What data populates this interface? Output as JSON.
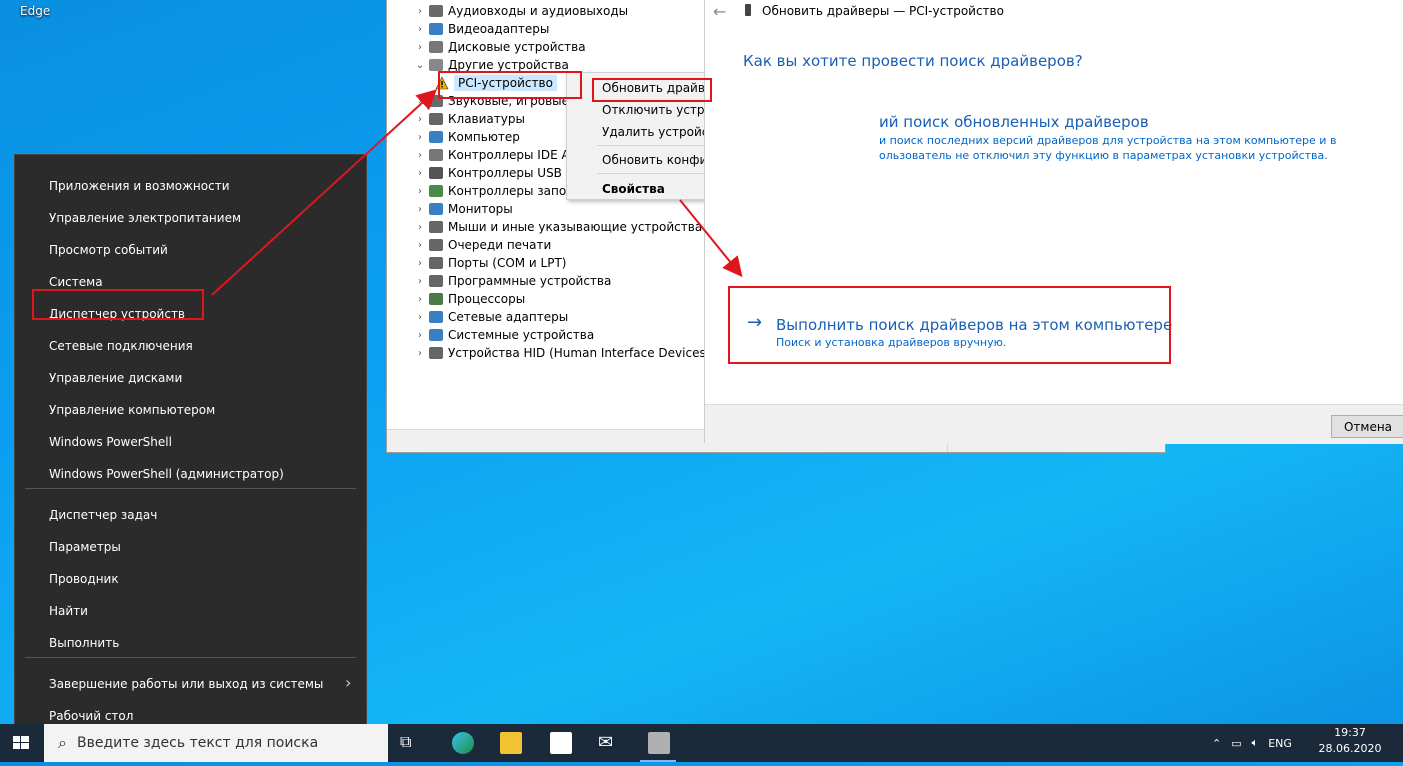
{
  "desktop": {
    "edge_label": "Edge"
  },
  "device_manager": {
    "tree": [
      {
        "label": "Аудиовходы и аудиовыходы",
        "icon": "audio-icon",
        "color": "#6a6a6a"
      },
      {
        "label": "Видеоадаптеры",
        "icon": "display-adapter-icon",
        "color": "#3a7fc1"
      },
      {
        "label": "Дисковые устройства",
        "icon": "disk-icon",
        "color": "#777"
      },
      {
        "label": "Другие устройства",
        "icon": "unknown-device-icon",
        "color": "#888"
      },
      {
        "label": "PCI-устройство",
        "icon": "warning-icon",
        "color": "#e8b200"
      },
      {
        "label": "Звуковые, игровые и",
        "icon": "sound-icon",
        "color": "#6a6a6a"
      },
      {
        "label": "Клавиатуры",
        "icon": "keyboard-icon",
        "color": "#666"
      },
      {
        "label": "Компьютер",
        "icon": "computer-icon",
        "color": "#3a7fc1"
      },
      {
        "label": "Контроллеры IDE ATA",
        "icon": "ide-icon",
        "color": "#777"
      },
      {
        "label": "Контроллеры USB",
        "icon": "usb-icon",
        "color": "#555"
      },
      {
        "label": "Контроллеры запом",
        "icon": "storage-icon",
        "color": "#4a8a4a"
      },
      {
        "label": "Мониторы",
        "icon": "monitor-icon",
        "color": "#3a7fc1"
      },
      {
        "label": "Мыши и иные указывающие устройства",
        "icon": "mouse-icon",
        "color": "#666"
      },
      {
        "label": "Очереди печати",
        "icon": "printer-icon",
        "color": "#666"
      },
      {
        "label": "Порты (COM и LPT)",
        "icon": "port-icon",
        "color": "#666"
      },
      {
        "label": "Программные устройства",
        "icon": "software-device-icon",
        "color": "#666"
      },
      {
        "label": "Процессоры",
        "icon": "cpu-icon",
        "color": "#4a7a4a"
      },
      {
        "label": "Сетевые адаптеры",
        "icon": "network-icon",
        "color": "#3a7fc1"
      },
      {
        "label": "Системные устройства",
        "icon": "system-icon",
        "color": "#3a7fc1"
      },
      {
        "label": "Устройства HID (Human Interface Devices)",
        "icon": "hid-icon",
        "color": "#666"
      }
    ],
    "context_menu": {
      "update": "Обновить драйвер",
      "disable": "Отключить устройство",
      "uninstall": "Удалить устройство",
      "scan": "Обновить конфигурацию оборудования",
      "properties": "Свойства"
    }
  },
  "update_dialog": {
    "title": "Обновить драйверы — PCI-устройство",
    "question": "Как вы хотите провести поиск драйверов?",
    "auto_title": "ий поиск обновленных драйверов",
    "auto_desc1": "и поиск последних версий драйверов для устройства на этом компьютере и в",
    "auto_desc2": "ользователь не отключил эту функцию в параметрах установки устройства.",
    "browse_title": "Выполнить поиск драйверов на этом компьютере",
    "browse_desc": "Поиск и установка драйверов вручную.",
    "cancel": "Отмена"
  },
  "winx_menu": {
    "items": [
      "Приложения и возможности",
      "Управление электропитанием",
      "Просмотр событий",
      "Система",
      "Диспетчер устройств",
      "Сетевые подключения",
      "Управление дисками",
      "Управление компьютером",
      "Windows PowerShell",
      "Windows PowerShell (администратор)",
      "Диспетчер задач",
      "Параметры",
      "Проводник",
      "Найти",
      "Выполнить",
      "Завершение работы или выход из системы",
      "Рабочий стол"
    ]
  },
  "taskbar": {
    "search_placeholder": "Введите здесь текст для поиска",
    "lang": "ENG",
    "time": "19:37",
    "date": "28.06.2020"
  }
}
